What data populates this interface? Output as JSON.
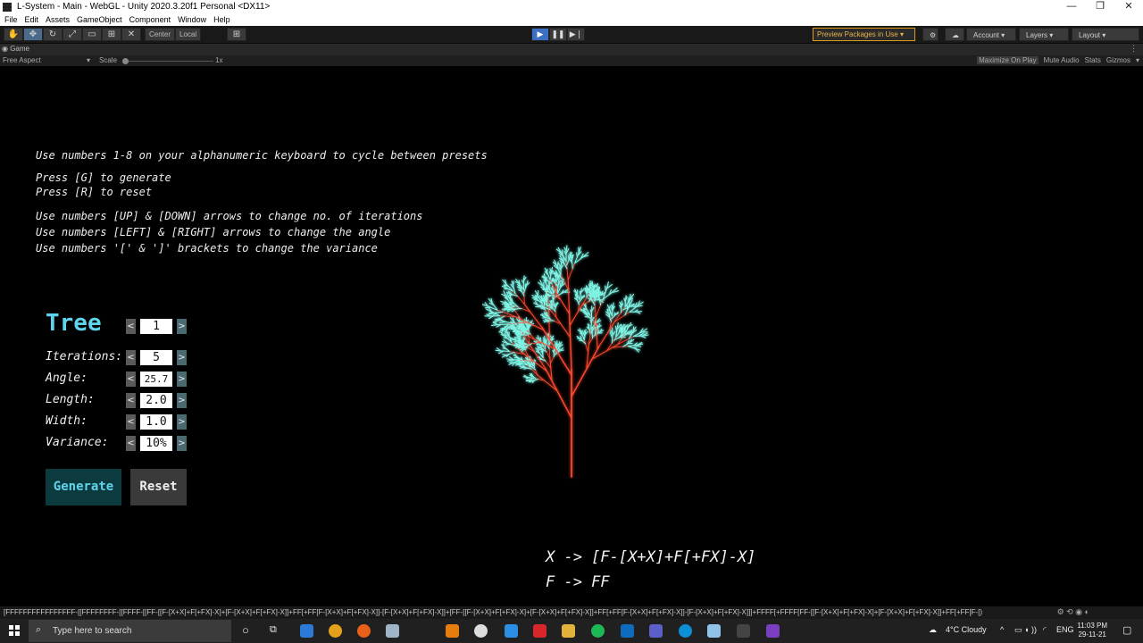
{
  "window": {
    "title": "L-System - Main - WebGL - Unity 2020.3.20f1 Personal <DX11>",
    "controls": [
      "—",
      "❐",
      "✕"
    ]
  },
  "menu": [
    "File",
    "Edit",
    "Assets",
    "GameObject",
    "Component",
    "Window",
    "Help"
  ],
  "toolbar": {
    "pivot": "Center",
    "space": "Local",
    "preview_packages": "Preview Packages in Use",
    "account": "Account",
    "layers": "Layers",
    "layout": "Layout"
  },
  "game_tab": {
    "tab_label": "Game",
    "aspect": "Free Aspect",
    "scale_label": "Scale",
    "scale_value": "1x",
    "maximize": "Maximize On Play",
    "mute": "Mute Audio",
    "stats": "Stats",
    "gizmos": "Gizmos"
  },
  "instructions": {
    "line1": "Use numbers 1-8 on your alphanumeric keyboard to cycle between presets",
    "line2": "Press [G] to generate",
    "line3": "Press [R] to reset",
    "line4": "Use numbers [UP] & [DOWN] arrows to change no. of iterations",
    "line5": "Use numbers [LEFT] & [RIGHT] arrows to change the angle",
    "line6": "Use numbers '[' & ']' brackets to change the variance"
  },
  "panel": {
    "preset_title": "Tree",
    "preset_value": "1",
    "iterations_label": "Iterations:",
    "iterations_value": "5",
    "angle_label": "Angle:",
    "angle_value": "25.7",
    "length_label": "Length:",
    "length_value": "2.0",
    "width_label": "Width:",
    "width_value": "1.0",
    "variance_label": "Variance:",
    "variance_value": "10%",
    "generate": "Generate",
    "reset": "Reset",
    "arrow_left": "<",
    "arrow_right": ">"
  },
  "rules": {
    "rule1": "X -> [F-[X+X]+F[+FX]-X]",
    "rule2": "F -> FF"
  },
  "status_message": "[FFFFFFFFFFFFFFFF-[[FFFFFFFF-[[FFFF-[[FF-[[F-[X+X]+F[+FX]-X]+[F-[X+X]+F[+FX]-X]]+FF[+FF[F-[X+X]+F[+FX]-X]]-[F-[X+X]+F[+FX]-X]]+[FF-[[F-[X+X]+F[+FX]-X]+[F-[X+X]+F[+FX]-X]]+FF[+FF[F-[X+X]+F[+FX]-X]]-[F-[X+X]+F[+FX]-X]]]+FFFF[+FFFF[FF-[[F-[X+X]+F[+FX]-X]+[F-[X+X]+F[+FX]-X]]+FF[+FF[F-[)",
  "taskbar": {
    "search_placeholder": "Type here to search",
    "weather": "4°C  Cloudy",
    "lang": "ENG",
    "time": "11:03 PM",
    "date": "29-11-21"
  },
  "colors": {
    "accent_cyan": "#5fd4ec",
    "branch_red": "#ff4a2e",
    "leaf_cyan": "#7ff5e6",
    "play_blue": "#3b6fc4"
  }
}
